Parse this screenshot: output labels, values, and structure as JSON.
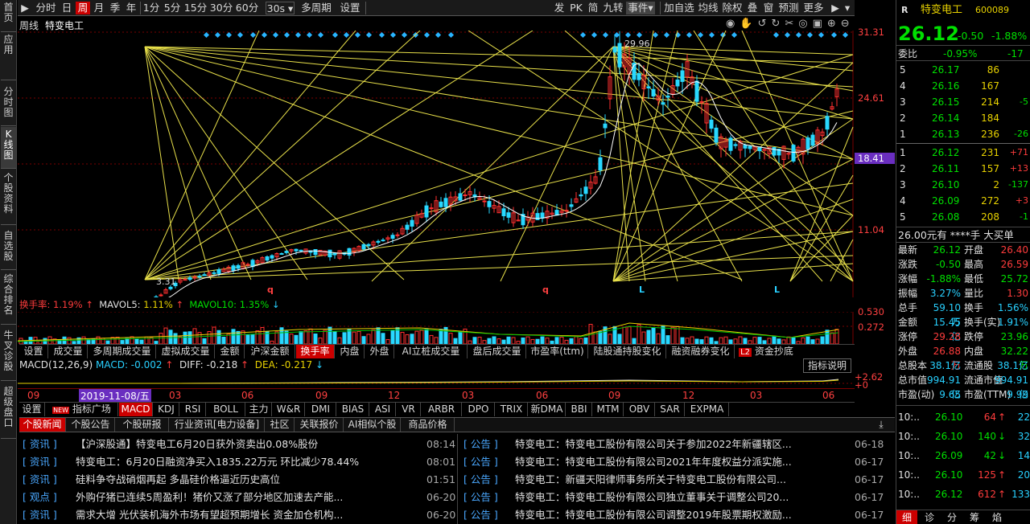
{
  "sidebar": {
    "tabs": [
      "首页",
      "应用",
      "分时图",
      "K线图",
      "个股资料",
      "自选股",
      "综合排名",
      "牛叉诊股",
      "超级盘口"
    ]
  },
  "topbar": {
    "left": [
      "分时",
      "日",
      "周",
      "月",
      "季",
      "年",
      "1分",
      "5分",
      "15分",
      "30分",
      "60分",
      "30s",
      "多周期",
      "设置"
    ],
    "right": [
      "发",
      "PK",
      "简",
      "九转",
      "事件",
      "加自选",
      "均线",
      "除权",
      "叠",
      "窗",
      "预测",
      "更多"
    ],
    "active": "周"
  },
  "chart_header": {
    "period": "周线",
    "name": "特变电工"
  },
  "price_axis": {
    "labels": [
      "31.31",
      "24.61",
      "18.41",
      "11.04"
    ],
    "highlight": "18.41"
  },
  "chart_annotations": {
    "high": "29.96",
    "low": "3.31",
    "marks": [
      "q",
      "q",
      "L",
      "L"
    ]
  },
  "volume": {
    "header": {
      "label": "换手率:",
      "value": "1.19%",
      "arrow": "↑",
      "mavol5_label": "MAVOL5:",
      "mavol5": "1.11%",
      "mavol5_arrow": "↑",
      "mavol10_label": "MAVOL10:",
      "mavol10": "1.35%",
      "mavol10_arrow": "↓"
    },
    "axis": [
      "0.530",
      "0.272"
    ]
  },
  "ind_tabs": [
    "设置",
    "成交量",
    "多周期成交量",
    "虚拟成交量",
    "金额",
    "沪深金额",
    "换手率",
    "内盘",
    "外盘",
    "AI立桩成交量",
    "盘后成交量",
    "市盈率(ttm)",
    "陆股通持股变化",
    "融资融券变化",
    "资金抄底"
  ],
  "ind_tabs_active": "换手率",
  "ind_tabs_badge": "L2",
  "macd": {
    "title": "MACD(12,26,9)",
    "macd": "MACD: -0.002",
    "diff": "DIFF: -0.218",
    "dea": "DEA: -0.217",
    "diff_arrow": "↑",
    "dea_arrow": "↓",
    "help": "指标说明",
    "axis": [
      "2.62",
      "0"
    ]
  },
  "date_axis": {
    "labels": [
      "09",
      "03",
      "06",
      "09",
      "12",
      "03",
      "06",
      "09",
      "12",
      "03",
      "06"
    ],
    "cursor": "2019-11-08/五"
  },
  "ind_tabs2": [
    "设置",
    "指标广场",
    "MACD",
    "KDJ",
    "RSI",
    "BOLL",
    "主力",
    "W&R",
    "DMI",
    "BIAS",
    "ASI",
    "VR",
    "ARBR",
    "DPO",
    "TRIX",
    "新DMA",
    "BBI",
    "MTM",
    "OBV",
    "SAR",
    "EXPMA"
  ],
  "ind_tabs2_active": "MACD",
  "ind_tabs2_badge": "NEW",
  "news_tabs": [
    "个股新闻",
    "个股公告",
    "个股研报",
    "行业资讯[电力设备]",
    "社区",
    "关联报价",
    "AI相似个股",
    "商品价格"
  ],
  "news_tabs_active": "个股新闻",
  "news_left": [
    {
      "tag": "资讯",
      "title": "【沪深股通】特变电工6月20日获外资卖出0.08%股份",
      "time": "08:14"
    },
    {
      "tag": "资讯",
      "title": "特变电工：6月20日融资净买入1835.22万元 环比减少78.44%",
      "time": "08:01"
    },
    {
      "tag": "资讯",
      "title": "硅料争夺战硝烟再起 多晶硅价格逼近历史高位",
      "time": "01:51"
    },
    {
      "tag": "观点",
      "title": "外购仔猪已连续5周盈利！猪价又涨了部分地区加速去产能...",
      "time": "06-20"
    },
    {
      "tag": "资讯",
      "title": "需求大增 光伏装机海外市场有望超预期增长 资金加仓机构...",
      "time": "06-20"
    }
  ],
  "news_right": [
    {
      "tag": "公告",
      "title": "特变电工：特变电工股份有限公司关于参加2022年新疆辖区...",
      "time": "06-18"
    },
    {
      "tag": "公告",
      "title": "特变电工：特变电工股份有限公司2021年年度权益分派实施...",
      "time": "06-17"
    },
    {
      "tag": "公告",
      "title": "特变电工：新疆天阳律师事务所关于特变电工股份有限公司...",
      "time": "06-17"
    },
    {
      "tag": "公告",
      "title": "特变电工：特变电工股份有限公司独立董事关于调整公司20...",
      "time": "06-17"
    },
    {
      "tag": "公告",
      "title": "特变电工：特变电工股份有限公司调整2019年股票期权激励...",
      "time": "06-17"
    }
  ],
  "quote": {
    "badge": "R",
    "name": "特变电工",
    "code": "600089",
    "price": "26.12",
    "change": "-0.50",
    "pct": "-1.88%",
    "weibi_label": "委比",
    "weibi": "-0.95%",
    "weicha": "-17",
    "sell_label": [
      "卖",
      "盘"
    ],
    "buy_label": [
      "买",
      "盘"
    ],
    "asks": [
      [
        "5",
        "26.17",
        "86",
        ""
      ],
      [
        "4",
        "26.16",
        "167",
        ""
      ],
      [
        "3",
        "26.15",
        "214",
        "-5"
      ],
      [
        "2",
        "26.14",
        "184",
        ""
      ],
      [
        "1",
        "26.13",
        "236",
        "-26"
      ]
    ],
    "bids": [
      [
        "1",
        "26.12",
        "231",
        "+71"
      ],
      [
        "2",
        "26.11",
        "157",
        "+13"
      ],
      [
        "3",
        "26.10",
        "2",
        "-137"
      ],
      [
        "4",
        "26.09",
        "272",
        "+3"
      ],
      [
        "5",
        "26.08",
        "208",
        "-1"
      ]
    ],
    "big_order": "26.00元有 ****手 大买单",
    "stats": [
      [
        "最新",
        "26.12",
        "开盘",
        "26.40"
      ],
      [
        "涨跌",
        "-0.50",
        "最高",
        "26.59"
      ],
      [
        "涨幅",
        "-1.88%",
        "最低",
        "25.72"
      ],
      [
        "振幅",
        "3.27%",
        "量比",
        "1.30"
      ],
      [
        "总手",
        "59.10万",
        "换手",
        "1.56%"
      ],
      [
        "金额",
        "15.45亿",
        "换手(实)",
        "1.91%"
      ],
      [
        "涨停",
        "29.28",
        "跌停",
        "23.96"
      ],
      [
        "外盘",
        "26.88万",
        "内盘",
        "32.22万"
      ],
      [
        "总股本",
        "38.1亿",
        "流通股",
        "38.1亿"
      ],
      [
        "总市值",
        "994.91亿",
        "流通市值",
        "994.91亿"
      ],
      [
        "市盈(动)",
        "9.65",
        "市盈(TTM)",
        "9.99"
      ]
    ],
    "ticks": [
      [
        "10:..",
        "26.10",
        "64",
        "↑",
        "22"
      ],
      [
        "10:..",
        "26.10",
        "140",
        "↓",
        "32"
      ],
      [
        "10:..",
        "26.09",
        "42",
        "↓",
        "14"
      ],
      [
        "10:..",
        "26.10",
        "125",
        "↑",
        "20"
      ],
      [
        "10:..",
        "26.12",
        "612",
        "↑",
        "133"
      ]
    ],
    "bottom_tabs": [
      "细",
      "诊",
      "分",
      "筹",
      "焰"
    ]
  }
}
